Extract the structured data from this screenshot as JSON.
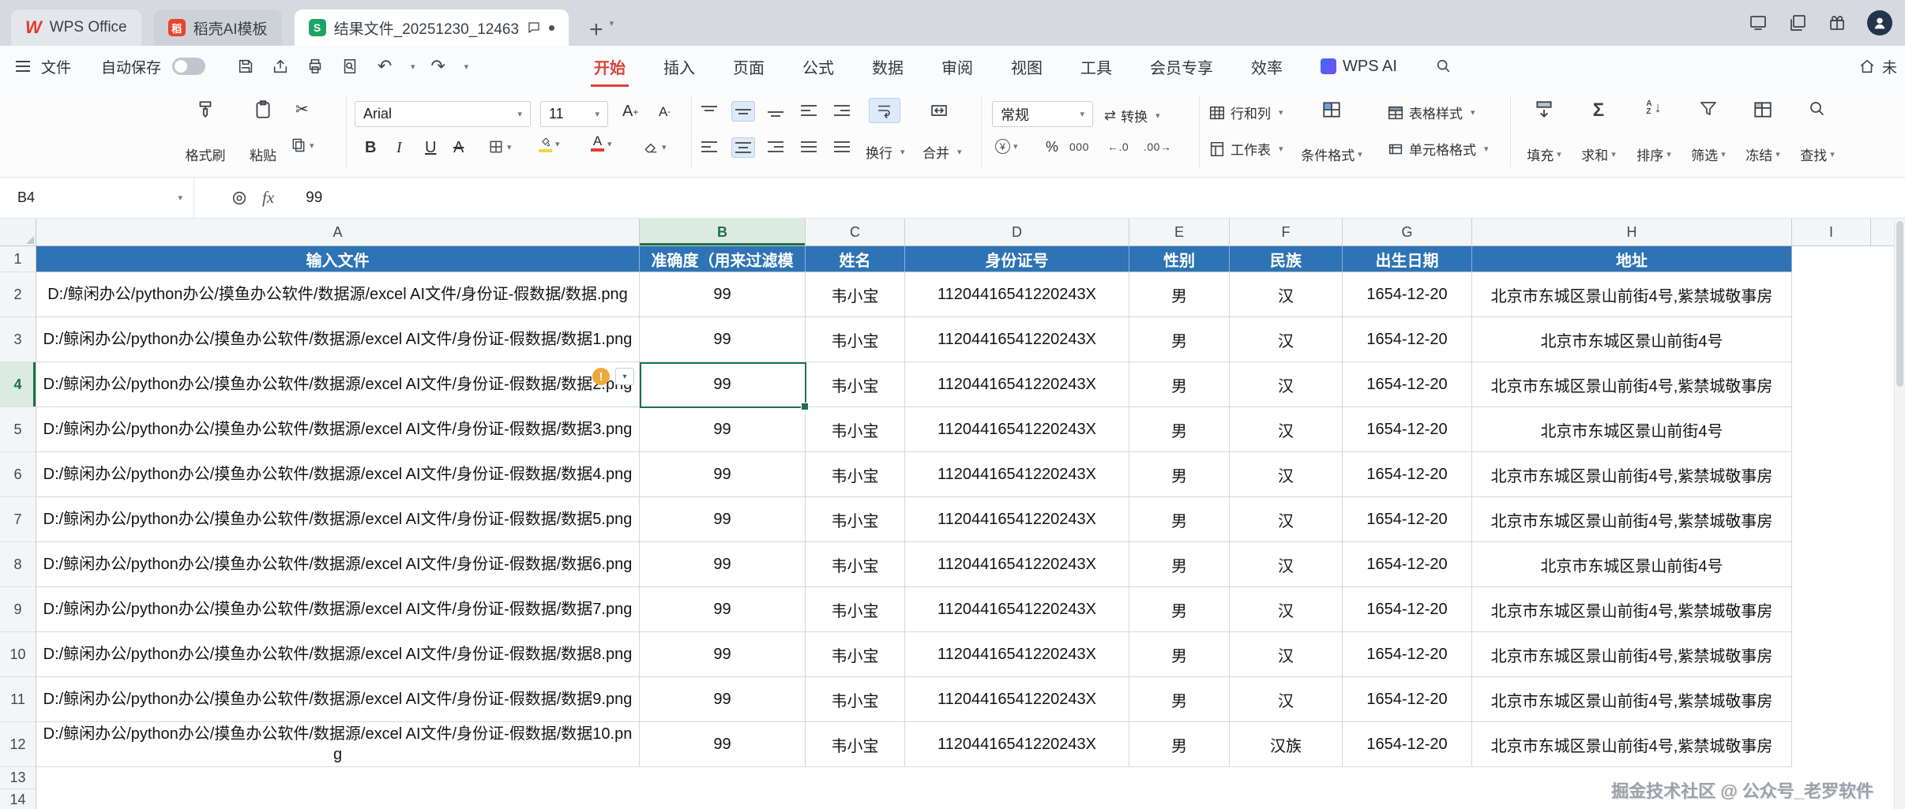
{
  "tabbar": {
    "tabs": [
      {
        "label": "WPS Office"
      },
      {
        "label": "稻壳AI模板"
      },
      {
        "label": "结果文件_20251230_12463"
      }
    ]
  },
  "menubar": {
    "file": "文件",
    "autosave": "自动保存",
    "ribbon_tabs": [
      "开始",
      "插入",
      "页面",
      "公式",
      "数据",
      "审阅",
      "视图",
      "工具",
      "会员专享",
      "效率",
      "WPS AI"
    ],
    "right_text": "未"
  },
  "ribbon": {
    "format_painter": "格式刷",
    "paste": "粘贴",
    "font_name": "Arial",
    "font_size": "11",
    "wrap": "换行",
    "merge": "合并",
    "number_format": "常规",
    "convert": "转换",
    "rows_cols": "行和列",
    "worksheet": "工作表",
    "cond_format": "条件格式",
    "table_style": "表格样式",
    "cell_format": "单元格格式",
    "fill": "填充",
    "sum": "求和",
    "sort": "排序",
    "filter": "筛选",
    "freeze": "冻结",
    "find": "查找",
    "thousands": "000"
  },
  "formula_bar": {
    "cell_ref": "B4",
    "fx_label": "fx",
    "value": "99"
  },
  "sheet": {
    "columns": [
      "A",
      "B",
      "C",
      "D",
      "E",
      "F",
      "G",
      "H",
      "I"
    ],
    "selected": {
      "col": "B",
      "row": 4
    },
    "header_row": [
      "输入文件",
      "准确度（用来过滤模",
      "姓名",
      "身份证号",
      "性别",
      "民族",
      "出生日期",
      "地址"
    ],
    "rows": [
      {
        "n": 2,
        "cells": [
          "D:/鲸闲办公/python办公/摸鱼办公软件/数据源/excel AI文件/身份证-假数据/数据.png",
          "99",
          "韦小宝",
          "11204416541220243X",
          "男",
          "汉",
          "1654-12-20",
          "北京市东城区景山前街4号,紫禁城敬事房"
        ]
      },
      {
        "n": 3,
        "cells": [
          "D:/鲸闲办公/python办公/摸鱼办公软件/数据源/excel AI文件/身份证-假数据/数据1.png",
          "99",
          "韦小宝",
          "11204416541220243X",
          "男",
          "汉",
          "1654-12-20",
          "北京市东城区景山前街4号"
        ]
      },
      {
        "n": 4,
        "warning": true,
        "cells": [
          "D:/鲸闲办公/python办公/摸鱼办公软件/数据源/excel AI文件/身份证-假数据/数据2.png",
          "99",
          "韦小宝",
          "11204416541220243X",
          "男",
          "汉",
          "1654-12-20",
          "北京市东城区景山前街4号,紫禁城敬事房"
        ]
      },
      {
        "n": 5,
        "cells": [
          "D:/鲸闲办公/python办公/摸鱼办公软件/数据源/excel AI文件/身份证-假数据/数据3.png",
          "99",
          "韦小宝",
          "11204416541220243X",
          "男",
          "汉",
          "1654-12-20",
          "北京市东城区景山前街4号"
        ]
      },
      {
        "n": 6,
        "cells": [
          "D:/鲸闲办公/python办公/摸鱼办公软件/数据源/excel AI文件/身份证-假数据/数据4.png",
          "99",
          "韦小宝",
          "11204416541220243X",
          "男",
          "汉",
          "1654-12-20",
          "北京市东城区景山前街4号,紫禁城敬事房"
        ]
      },
      {
        "n": 7,
        "cells": [
          "D:/鲸闲办公/python办公/摸鱼办公软件/数据源/excel AI文件/身份证-假数据/数据5.png",
          "99",
          "韦小宝",
          "11204416541220243X",
          "男",
          "汉",
          "1654-12-20",
          "北京市东城区景山前街4号,紫禁城敬事房"
        ]
      },
      {
        "n": 8,
        "cells": [
          "D:/鲸闲办公/python办公/摸鱼办公软件/数据源/excel AI文件/身份证-假数据/数据6.png",
          "99",
          "韦小宝",
          "11204416541220243X",
          "男",
          "汉",
          "1654-12-20",
          "北京市东城区景山前街4号"
        ]
      },
      {
        "n": 9,
        "cells": [
          "D:/鲸闲办公/python办公/摸鱼办公软件/数据源/excel AI文件/身份证-假数据/数据7.png",
          "99",
          "韦小宝",
          "11204416541220243X",
          "男",
          "汉",
          "1654-12-20",
          "北京市东城区景山前街4号,紫禁城敬事房"
        ]
      },
      {
        "n": 10,
        "cells": [
          "D:/鲸闲办公/python办公/摸鱼办公软件/数据源/excel AI文件/身份证-假数据/数据8.png",
          "99",
          "韦小宝",
          "11204416541220243X",
          "男",
          "汉",
          "1654-12-20",
          "北京市东城区景山前街4号,紫禁城敬事房"
        ]
      },
      {
        "n": 11,
        "cells": [
          "D:/鲸闲办公/python办公/摸鱼办公软件/数据源/excel AI文件/身份证-假数据/数据9.png",
          "99",
          "韦小宝",
          "11204416541220243X",
          "男",
          "汉",
          "1654-12-20",
          "北京市东城区景山前街4号,紫禁城敬事房"
        ]
      },
      {
        "n": 12,
        "cells": [
          "D:/鲸闲办公/python办公/摸鱼办公软件/数据源/excel AI文件/身份证-假数据/数据10.png",
          "99",
          "韦小宝",
          "11204416541220243X",
          "男",
          "汉族",
          "1654-12-20",
          "北京市东城区景山前街4号,紫禁城敬事房"
        ]
      }
    ],
    "empty_rows": [
      13,
      14
    ]
  },
  "watermark": "掘金技术社区 @ 公众号_老罗软件"
}
